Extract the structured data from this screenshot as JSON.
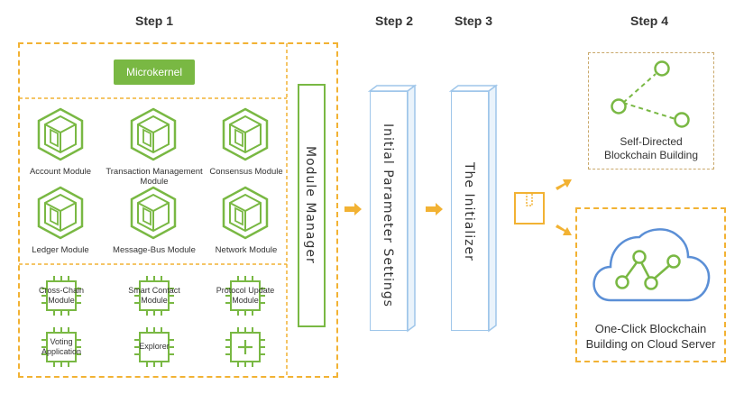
{
  "steps": {
    "s1": "Step 1",
    "s2": "Step 2",
    "s3": "Step 3",
    "s4": "Step 4"
  },
  "microkernel": "Microkernel",
  "modules": [
    "Account Module",
    "Transaction Management Module",
    "Consensus Module",
    "Ledger Module",
    "Message-Bus Module",
    "Network Module"
  ],
  "plugins": [
    "Cross-Chain Module",
    "Smart Contact Module",
    "Protocol Update Module",
    "Voting Application",
    "Explorer",
    ""
  ],
  "module_manager": "Module Manager",
  "initial_parameter_settings": "Initial Parameter Settings",
  "initializer": "The Initializer",
  "self_directed": {
    "line1": "Self-Directed",
    "line2": "Blockchain Building"
  },
  "one_click": {
    "line1": "One-Click Blockchain",
    "line2": "Building on Cloud Server"
  },
  "colors": {
    "green": "#79b843",
    "orange": "#f2b233",
    "blue": "#9fc6ea",
    "cloud": "#5b8fd6"
  },
  "icons": {
    "module": "hexagon-cube-icon",
    "plugin": "chip-icon",
    "plus": "plus-icon",
    "package": "package-icon",
    "arrow": "arrow-right-icon"
  }
}
